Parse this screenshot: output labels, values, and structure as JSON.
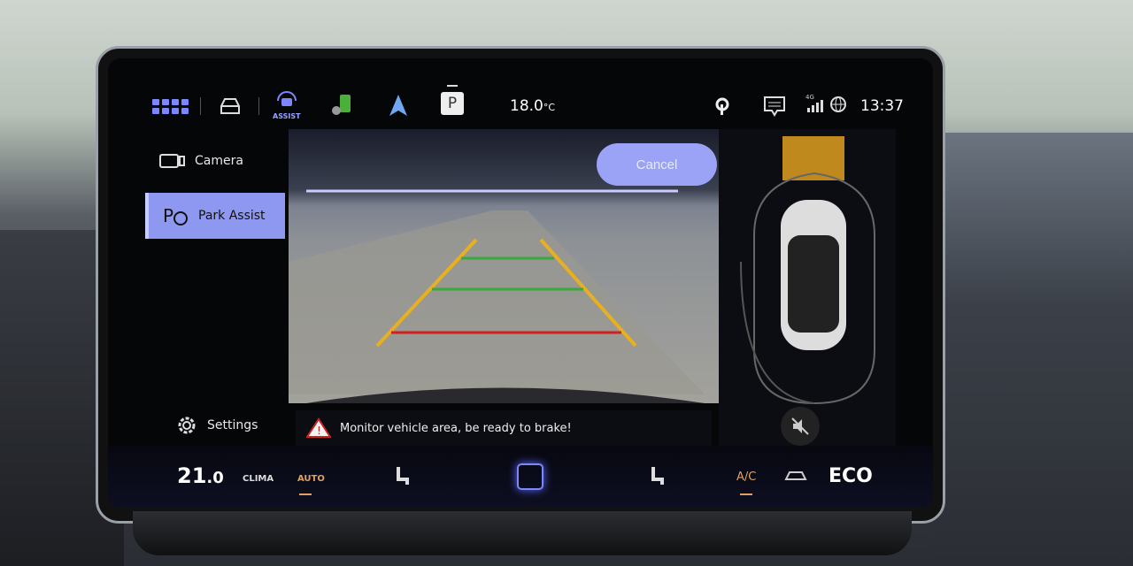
{
  "status_bar": {
    "assist_label": "ASSIST",
    "gear": "P",
    "temperature": "18.0",
    "temp_unit": "°C",
    "time": "13:37",
    "network": "4G",
    "icons": [
      "apps-grid-icon",
      "car-icon",
      "assist-icon",
      "battery-charging-icon",
      "navigation-arrow-icon",
      "park-gear-icon",
      "wireless-charging-icon",
      "message-icon",
      "signal-icon",
      "globe-icon"
    ]
  },
  "sidebar": {
    "items": [
      {
        "label": "Camera",
        "icon": "camera-icon"
      },
      {
        "label": "Park Assist",
        "icon": "park-assist-icon",
        "active": true
      }
    ],
    "settings_label": "Settings"
  },
  "camera_view": {
    "cancel_label": "Cancel",
    "warning": "Monitor vehicle area, be ready to brake!"
  },
  "climate_bar": {
    "temperature": "21",
    "temperature_decimal": ".0",
    "clima_label": "CLIMA",
    "auto_label": "AUTO",
    "ac_label": "A/C",
    "eco_label": "ECO"
  },
  "colors": {
    "accent": "#8e98f0",
    "guide_yellow": "#e8b020",
    "guide_green": "#3aa83a",
    "guide_red": "#d02020",
    "sensor_orange": "#e0a020"
  }
}
